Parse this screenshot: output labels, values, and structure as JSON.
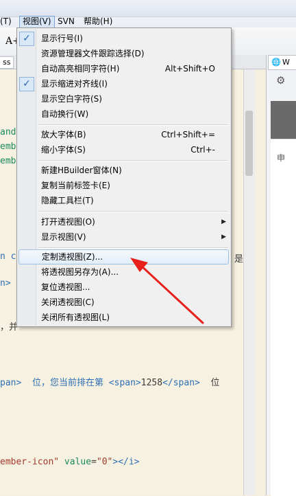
{
  "menubar": {
    "left_fragment": "(T)",
    "view_menu": "视图(V)",
    "svn_menu": "SVN",
    "help_menu": "帮助(H)"
  },
  "toolbar": {
    "font_icon_label": "A+"
  },
  "tab": {
    "label": "ss"
  },
  "right_panel": {
    "tab_label": "W",
    "content_text": "申"
  },
  "editor": {
    "lines": [
      {
        "frag": "and"
      },
      {
        "frag": "emb"
      },
      {
        "frag": "emb"
      },
      {
        "frag": "n c"
      },
      {
        "frag": "n>"
      },
      {
        "frag": "，并"
      },
      {
        "frag": "pan>  位，您当前排在第 ",
        "tag_open": "<span>",
        "num": "1258",
        "tag_close": "</span>",
        "tail": "  位"
      },
      {
        "frag": "ember-icon\" ",
        "attr": "value",
        "eq": "=",
        "val": "\"0\"",
        "close": "></i>"
      }
    ],
    "right_overflow": "是"
  },
  "view_menu": {
    "items": [
      {
        "label": "显示行号(I)",
        "shortcut": "",
        "checked": true,
        "submenu": false
      },
      {
        "label": "资源管理器文件跟踪选择(D)",
        "shortcut": "",
        "checked": false,
        "submenu": false
      },
      {
        "label": "自动高亮相同字符(H)",
        "shortcut": "Alt+Shift+O",
        "checked": false,
        "submenu": false
      },
      {
        "label": "显示缩进对齐线(I)",
        "shortcut": "",
        "checked": true,
        "submenu": false
      },
      {
        "label": "显示空白字符(S)",
        "shortcut": "",
        "checked": false,
        "submenu": false
      },
      {
        "label": "自动换行(W)",
        "shortcut": "",
        "checked": false,
        "submenu": false
      },
      {
        "label": "放大字体(B)",
        "shortcut": "Ctrl+Shift+=",
        "checked": false,
        "submenu": false
      },
      {
        "label": "缩小字体(S)",
        "shortcut": "Ctrl+-",
        "checked": false,
        "submenu": false
      },
      {
        "label": "新建HBuilder窗体(N)",
        "shortcut": "",
        "checked": false,
        "submenu": false
      },
      {
        "label": "复制当前标签卡(E)",
        "shortcut": "",
        "checked": false,
        "submenu": false
      },
      {
        "label": "隐藏工具栏(T)",
        "shortcut": "",
        "checked": false,
        "submenu": false
      },
      {
        "label": "打开透视图(O)",
        "shortcut": "",
        "checked": false,
        "submenu": true
      },
      {
        "label": "显示视图(V)",
        "shortcut": "",
        "checked": false,
        "submenu": true
      },
      {
        "label": "定制透视图(Z)...",
        "shortcut": "",
        "checked": false,
        "submenu": false,
        "highlighted": true
      },
      {
        "label": "将透视图另存为(A)...",
        "shortcut": "",
        "checked": false,
        "submenu": false
      },
      {
        "label": "复位透视图...",
        "shortcut": "",
        "checked": false,
        "submenu": false
      },
      {
        "label": "关闭透视图(C)",
        "shortcut": "",
        "checked": false,
        "submenu": false
      },
      {
        "label": "关闭所有透视图(L)",
        "shortcut": "",
        "checked": false,
        "submenu": false
      }
    ]
  },
  "colors": {
    "editor_bg": "#f7f1e1",
    "check_accent": "#2a64b5",
    "annotation_arrow": "#e8201b"
  }
}
